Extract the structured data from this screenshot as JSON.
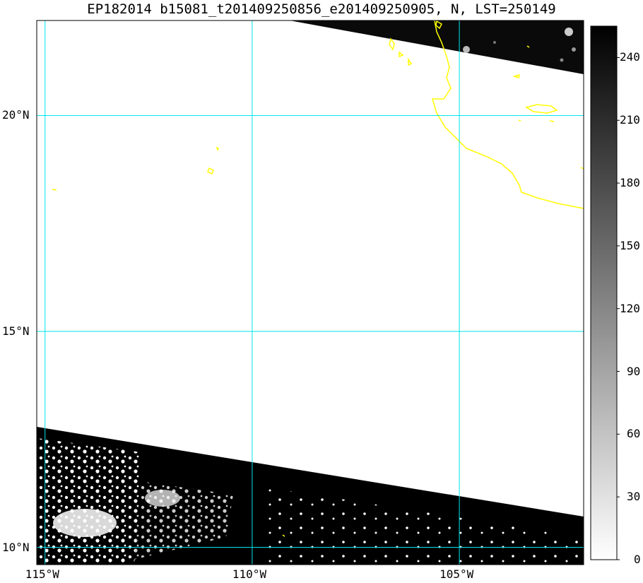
{
  "title": "EP182014 b15081_t201409250856_e201409250905, N, LST=250149",
  "map": {
    "lat_range": [
      9.6,
      22.2
    ],
    "lon_range": [
      -115.2,
      -102.0
    ],
    "graticule_color": "#00e5ee",
    "coastline_color": "#ffff00",
    "lat_ticks": [
      {
        "value": 20,
        "label": "20°N"
      },
      {
        "value": 15,
        "label": "15°N"
      },
      {
        "value": 10,
        "label": "10°N"
      }
    ],
    "lon_ticks": [
      {
        "value": -115,
        "label": "115°W"
      },
      {
        "value": -110,
        "label": "110°W"
      },
      {
        "value": -105,
        "label": "105°W"
      }
    ]
  },
  "colorbar": {
    "min": 0,
    "max": 255,
    "colormap": "gray_reversed",
    "ticks": [
      {
        "value": 240,
        "label": "240"
      },
      {
        "value": 210,
        "label": "210"
      },
      {
        "value": 180,
        "label": "180"
      },
      {
        "value": 150,
        "label": "150"
      },
      {
        "value": 120,
        "label": "120"
      },
      {
        "value": 90,
        "label": "90"
      },
      {
        "value": 60,
        "label": "60"
      },
      {
        "value": 30,
        "label": "30"
      },
      {
        "value": 0,
        "label": "0"
      }
    ]
  }
}
